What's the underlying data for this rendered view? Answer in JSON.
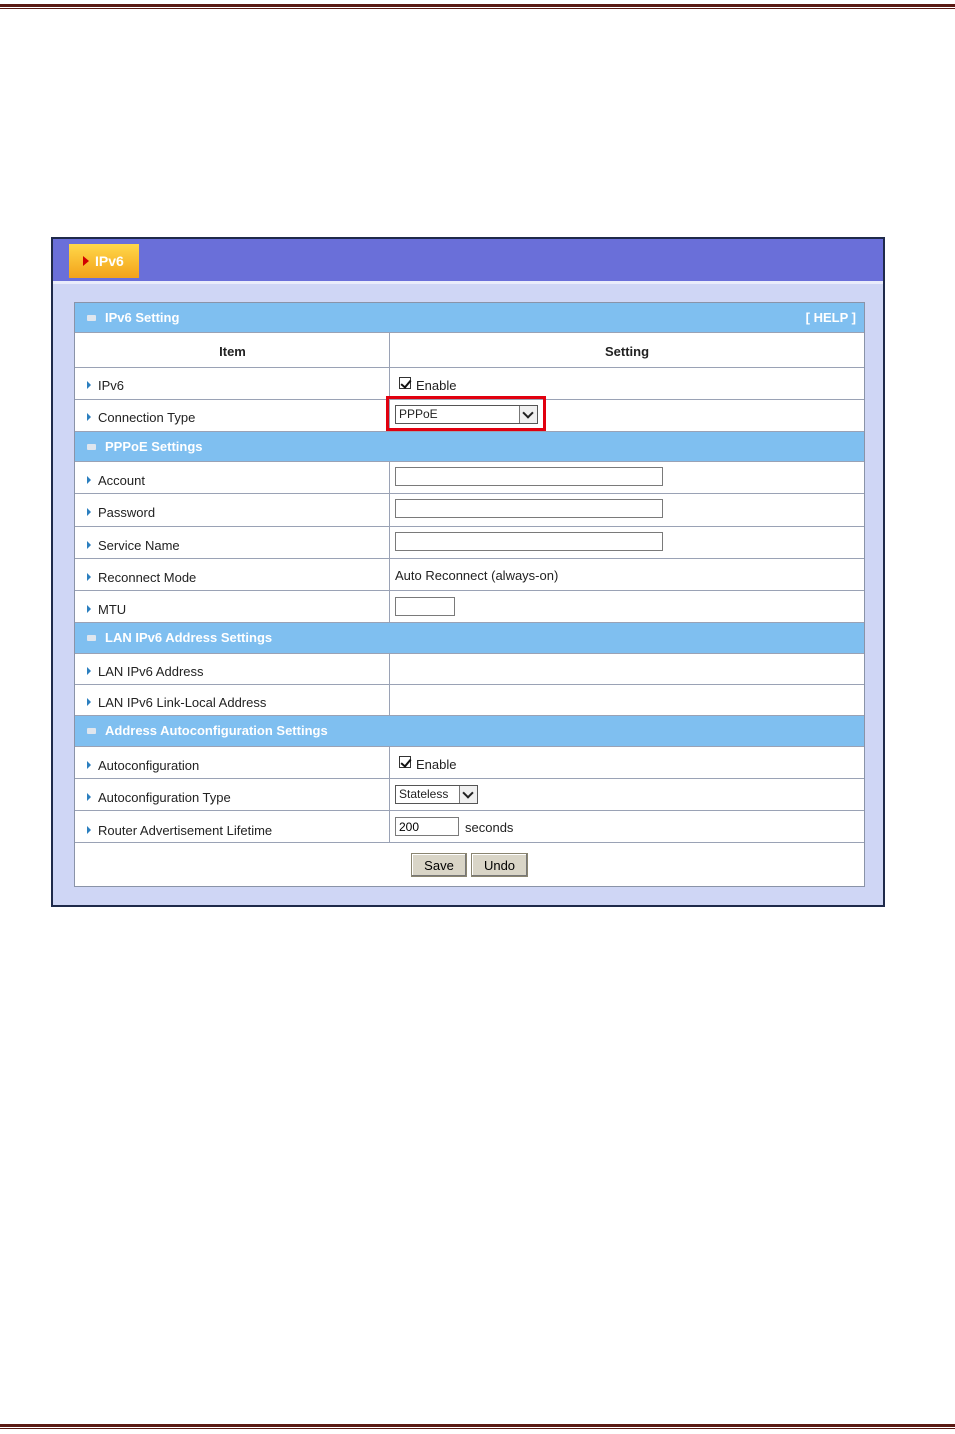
{
  "window": {
    "tab_label": "IPv6"
  },
  "help_label": "[ HELP ]",
  "ipv6_setting": {
    "title": "IPv6 Setting",
    "col_item": "Item",
    "col_setting": "Setting",
    "ipv6": {
      "label": "IPv6",
      "checkbox_label": "Enable",
      "checked": true
    },
    "connection_type": {
      "label": "Connection Type",
      "value": "PPPoE"
    }
  },
  "pppoe_settings": {
    "title": "PPPoE Settings",
    "account": {
      "label": "Account",
      "value": ""
    },
    "password": {
      "label": "Password",
      "value": ""
    },
    "service_name": {
      "label": "Service Name",
      "value": ""
    },
    "reconnect_mode": {
      "label": "Reconnect Mode",
      "value": "Auto Reconnect (always-on)"
    },
    "mtu": {
      "label": "MTU",
      "value": ""
    }
  },
  "lan_settings": {
    "title": "LAN IPv6 Address Settings",
    "lan_address": {
      "label": "LAN IPv6 Address"
    },
    "link_local": {
      "label": "LAN IPv6 Link-Local Address"
    }
  },
  "autoconf_settings": {
    "title": "Address Autoconfiguration Settings",
    "autoconfiguration": {
      "label": "Autoconfiguration",
      "checkbox_label": "Enable",
      "checked": true
    },
    "type": {
      "label": "Autoconfiguration Type",
      "value": "Stateless"
    },
    "lifetime": {
      "label": "Router Advertisement Lifetime",
      "value": "200",
      "unit": "seconds"
    }
  },
  "buttons": {
    "save": "Save",
    "undo": "Undo"
  },
  "colors": {
    "topbar": "#6a6fd9",
    "section_header": "#7fbff0",
    "highlight": "#e1000f",
    "frame_bg": "#cfd6f5"
  }
}
